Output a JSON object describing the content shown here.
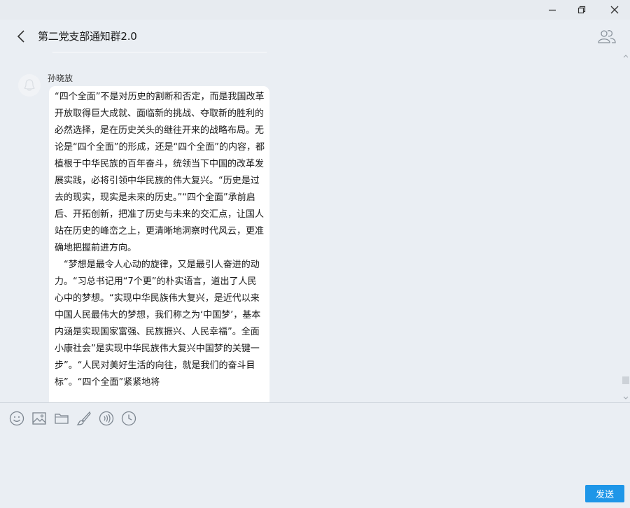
{
  "window": {
    "minimize": "minimize",
    "restore": "restore",
    "close": "close"
  },
  "header": {
    "title": "第二党支部通知群2.0"
  },
  "message": {
    "sender": "孙晓放",
    "paragraphs": [
      "“四个全面”不是对历史的割断和否定，而是我国改革开放取得巨大成就、面临新的挑战、夺取新的胜利的必然选择，是在历史关头的继往开来的战略布局。无论是“四个全面”的形成，还是“四个全面”的内容，都植根于中华民族的百年奋斗，统领当下中国的改革发展实践，必将引领中华民族的伟大复兴。“历史是过去的现实，现实是未来的历史。”“四个全面”承前启后、开拓创新，把准了历史与未来的交汇点，让国人站在历史的峰峦之上，更清晰地洞察时代风云，更准确地把握前进方向。",
      "　“梦想是最令人心动的旋律，又是最引人奋进的动力。“习总书记用“7个更”的朴实语言，道出了人民心中的梦想。“实现中华民族伟大复兴，是近代以来中国人民最伟大的梦想，我们称之为‘中国梦’，基本内涵是实现国家富强、民族振兴、人民幸福”。全面小康社会”是实现中华民族伟大复兴中国梦的关键一步”。“人民对美好生活的向往，就是我们的奋斗目标”。“四个全面”紧紧地将"
    ]
  },
  "toolbar": {
    "icons": [
      "emoji-icon",
      "image-icon",
      "folder-icon",
      "brush-icon",
      "voice-icon",
      "clock-icon"
    ]
  },
  "send": {
    "label": "发送"
  },
  "colors": {
    "accent": "#1e96e8",
    "background": "#eaeef3",
    "bubble": "#ffffff"
  }
}
